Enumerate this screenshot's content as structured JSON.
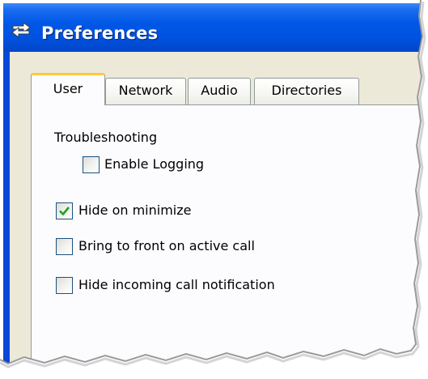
{
  "window": {
    "title": "Preferences"
  },
  "tabs": [
    {
      "label": "User",
      "active": true
    },
    {
      "label": "Network",
      "active": false
    },
    {
      "label": "Audio",
      "active": false
    },
    {
      "label": "Directories",
      "active": false
    }
  ],
  "user_tab": {
    "section_heading": "Troubleshooting",
    "options": [
      {
        "label": "Enable Logging",
        "checked": false
      },
      {
        "label": "Hide on minimize",
        "checked": true
      },
      {
        "label": "Bring to front on active call",
        "checked": false
      },
      {
        "label": "Hide incoming call notification",
        "checked": false
      }
    ]
  },
  "colors": {
    "titlebar": "#0058e6",
    "dialog_face": "#ece9d8",
    "tab_panel": "#fcfcfe",
    "active_tab_accent": "#ffc83c",
    "checkmark": "#21a121",
    "checkbox_border": "#1c5180"
  },
  "icons": {
    "app": "s-shaped-arrows-icon",
    "check": "checkmark-icon"
  }
}
